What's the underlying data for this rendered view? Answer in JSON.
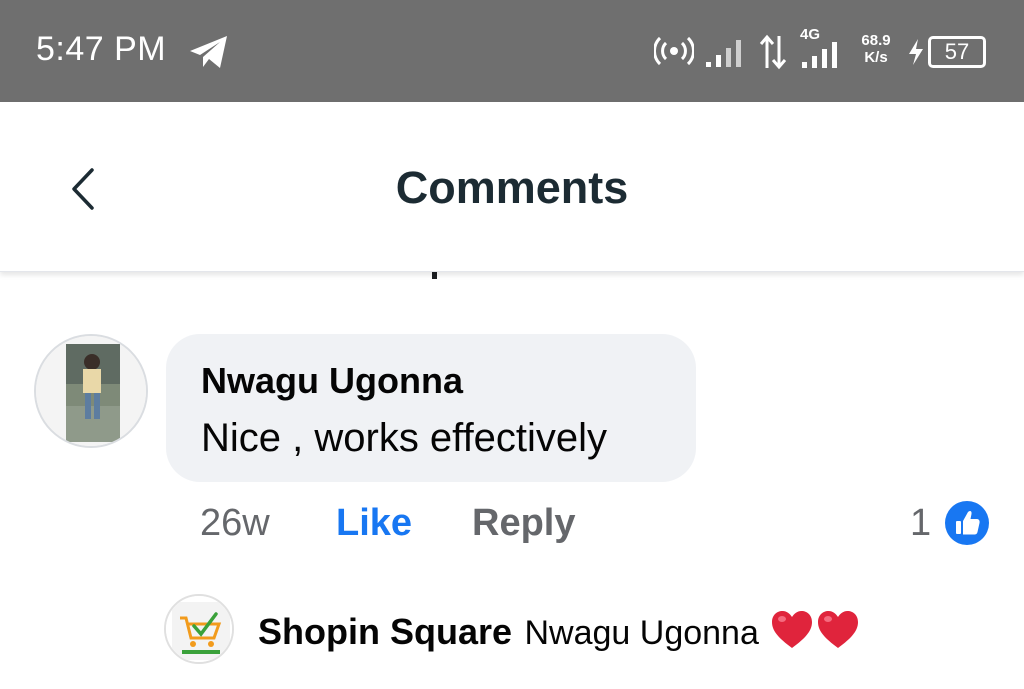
{
  "status_bar": {
    "time": "5:47 PM",
    "network_type": "4G",
    "speed_value": "68.9",
    "speed_unit": "K/s",
    "battery": "57",
    "icons": [
      "telegram-icon",
      "hotspot-icon",
      "signal-icon",
      "data-arrows-icon",
      "signal-icon",
      "charging-icon",
      "battery-icon"
    ]
  },
  "header": {
    "title": "Comments",
    "back_icon": "chevron-left-icon"
  },
  "comment": {
    "author": "Nwagu Ugonna",
    "text": "Nice , works effectively",
    "time": "26w",
    "like_label": "Like",
    "reply_label": "Reply",
    "reaction_count": "1",
    "reaction_icon": "thumbs-up-icon"
  },
  "reply": {
    "author": "Shopin Square",
    "text": "Nwagu Ugonna",
    "emoji": "heart-heart",
    "logo_text": "SHOPIN SQUARE"
  },
  "colors": {
    "status_bar": "#6f6f6f",
    "bubble": "#f0f2f5",
    "accent": "#1877f2",
    "muted_text": "#65676b",
    "heart": "#e0243c"
  }
}
